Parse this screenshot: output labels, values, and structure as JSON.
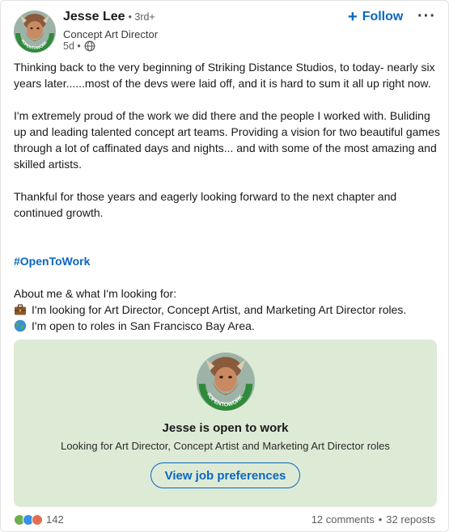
{
  "author": {
    "name": "Jesse Lee",
    "degree": "• 3rd+",
    "headline": "Concept Art Director",
    "time": "5d •",
    "avatar_badge_text": "#OPENTOWORK"
  },
  "actions": {
    "follow_label": "Follow",
    "follow_icon": "+",
    "more_icon": "···"
  },
  "post": {
    "p1": "Thinking back to the very beginning of Striking Distance Studios, to today- nearly six years later......most of the devs were laid off, and it is hard to sum it all up right now.",
    "p2": "I'm extremely proud of the work we did there and the people I worked with. Buliding up and leading talented concept art teams. Providing a vision for two beautiful games through a lot of caffinated days and nights... and with some of the most amazing and skilled artists.",
    "p3": "Thankful for those years and eagerly looking forward to the next chapter and continued growth.",
    "hashtag": "#OpenToWork",
    "about_heading": "About me & what I'm looking for:",
    "looking_for": "I'm looking for Art Director, Concept Artist, and Marketing Art Director roles.",
    "open_to": "I'm open to roles in San Francisco Bay Area.",
    "briefcase_icon": "briefcase-emoji",
    "globe_icon": "globe-emoji"
  },
  "open_to_work": {
    "title": "Jesse is open to work",
    "subtitle": "Looking for Art Director, Concept Artist and Marketing Art Director roles",
    "button_label": "View job preferences"
  },
  "footer": {
    "reaction_count": "142",
    "comments": "12 comments",
    "separator": "•",
    "reposts": "32 reposts"
  },
  "colors": {
    "accent": "#0a66c2",
    "otw_green": "#ddebd6",
    "badge_green": "#2f8a3a"
  }
}
